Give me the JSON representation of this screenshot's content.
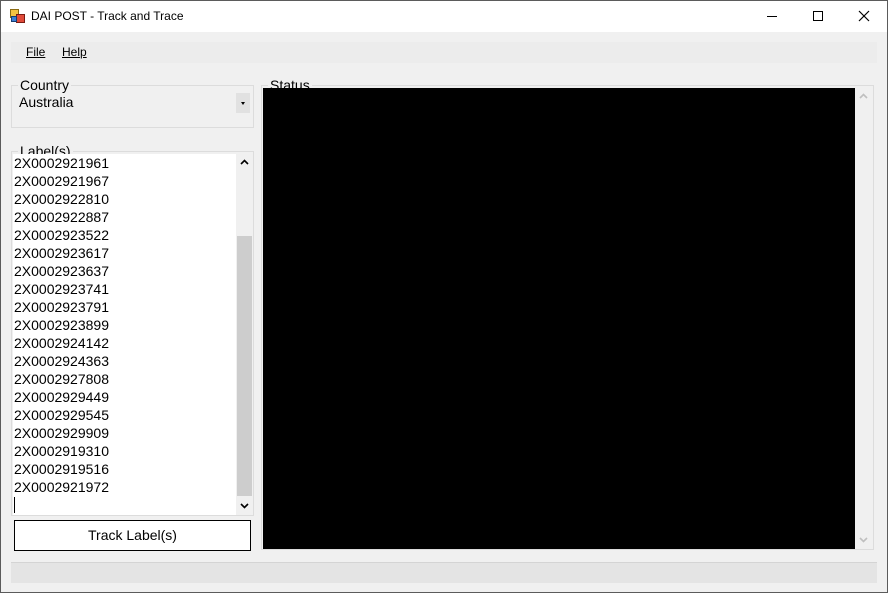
{
  "window": {
    "title": "DAI POST - Track and Trace"
  },
  "menu": {
    "file": "File",
    "help": "Help"
  },
  "country": {
    "legend": "Country",
    "selected": "Australia"
  },
  "labels": {
    "legend": "Label(s)",
    "items": [
      "2X0002921961",
      "2X0002921967",
      "2X0002922810",
      "2X0002922887",
      "2X0002923522",
      "2X0002923617",
      "2X0002923637",
      "2X0002923741",
      "2X0002923791",
      "2X0002923899",
      "2X0002924142",
      "2X0002924363",
      "2X0002927808",
      "2X0002929449",
      "2X0002929545",
      "2X0002929909",
      "2X0002919310",
      "2X0002919516",
      "2X0002921972"
    ]
  },
  "status": {
    "legend": "Status"
  },
  "actions": {
    "track_label": "Track Label(s)"
  }
}
